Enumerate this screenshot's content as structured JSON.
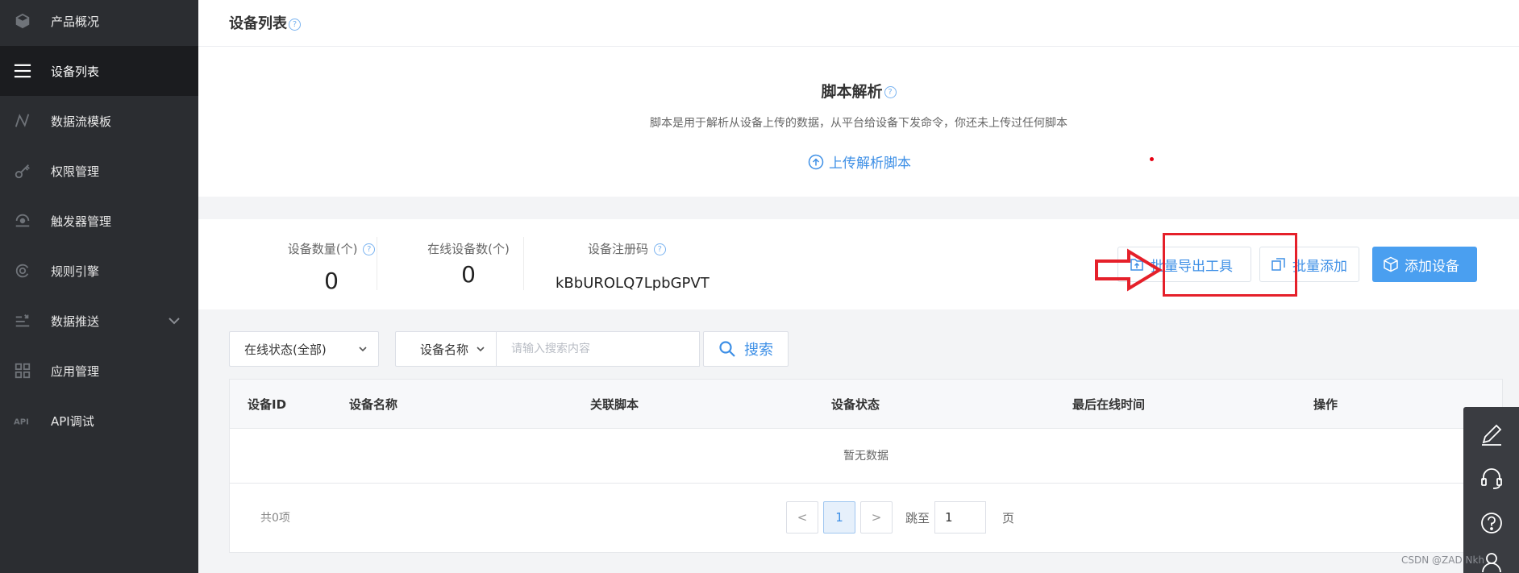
{
  "sidebar": {
    "items": [
      {
        "label": "产品概况",
        "icon": "cube-icon"
      },
      {
        "label": "设备列表",
        "icon": "list-icon",
        "active": true
      },
      {
        "label": "数据流模板",
        "icon": "flow-icon"
      },
      {
        "label": "权限管理",
        "icon": "key-icon"
      },
      {
        "label": "触发器管理",
        "icon": "trigger-icon"
      },
      {
        "label": "规则引擎",
        "icon": "engine-icon"
      },
      {
        "label": "数据推送",
        "icon": "push-icon",
        "expandable": true
      },
      {
        "label": "应用管理",
        "icon": "grid-icon"
      },
      {
        "label": "API调试",
        "icon": "api-icon"
      }
    ]
  },
  "header": {
    "title": "设备列表",
    "help": "?"
  },
  "script": {
    "title": "脚本解析",
    "help": "?",
    "description": "脚本是用于解析从设备上传的数据，从平台给设备下发命令，你还未上传过任何脚本",
    "upload_label": "上传解析脚本"
  },
  "stats": {
    "device_count_label": "设备数量(个)",
    "device_count": "0",
    "online_count_label": "在线设备数(个)",
    "online_count": "0",
    "reg_code_label": "设备注册码",
    "reg_code": "kBbUROLQ7LpbGPVT",
    "help": "?"
  },
  "actions": {
    "export_label": "批量导出工具",
    "batch_add_label": "批量添加",
    "add_label": "添加设备"
  },
  "filters": {
    "status_selected": "在线状态(全部)",
    "field_selected": "设备名称",
    "search_placeholder": "请输入搜索内容",
    "search_label": "搜索"
  },
  "table": {
    "columns": [
      "设备ID",
      "设备名称",
      "关联脚本",
      "设备状态",
      "最后在线时间",
      "操作"
    ],
    "empty_text": "暂无数据"
  },
  "pagination": {
    "total": "共0项",
    "prev": "<",
    "current": "1",
    "next": ">",
    "jump_label": "跳至",
    "jump_value": "1",
    "page_unit": "页"
  },
  "float_toolbar": [
    "edit-icon",
    "headset-icon",
    "help-circle-icon",
    "user-icon"
  ],
  "watermark": "CSDN @ZAD Nkh",
  "colors": {
    "accent": "#4a9ff0",
    "sidebar": "#2b2d31",
    "highlight": "#e5202a"
  }
}
